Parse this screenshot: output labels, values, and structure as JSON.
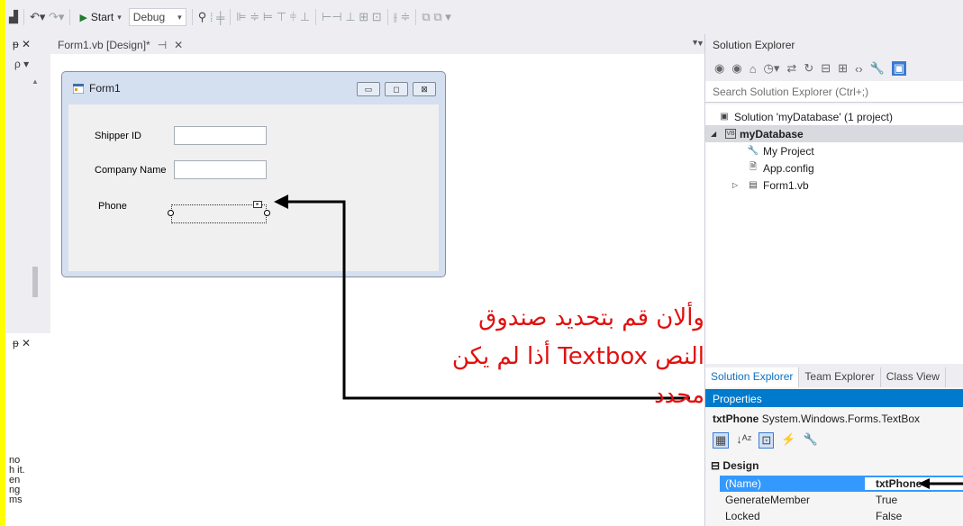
{
  "toolbar": {
    "start_label": "Start",
    "config_value": "Debug"
  },
  "left_panel": {
    "pin": "ᵽ ✕",
    "search": "ρ ▾",
    "lower_pin": "ᵽ ✕",
    "lower_lines": [
      "no",
      "h it.",
      "en",
      "ng",
      "ms"
    ]
  },
  "editor": {
    "tab_label": "Form1.vb [Design]*",
    "tab_pin": "⊣",
    "tab_close": "✕"
  },
  "form": {
    "title": "Form1",
    "fields": [
      {
        "label": "Shipper ID"
      },
      {
        "label": "Company Name"
      },
      {
        "label": "Phone"
      }
    ],
    "caption_buttons": [
      "▭",
      "◻",
      "⊠"
    ]
  },
  "annotation": {
    "lines": [
      "وألان قم بتحديد صندوق",
      "النص  Textbox أذا لم يكن",
      "محدد"
    ],
    "color": "#e01010"
  },
  "solution_explorer": {
    "title": "Solution Explorer",
    "search_placeholder": "Search Solution Explorer (Ctrl+;)",
    "tree": [
      {
        "label": "Solution 'myDatabase' (1 project)"
      },
      {
        "label": "myDatabase"
      },
      {
        "label": "My Project"
      },
      {
        "label": "App.config"
      },
      {
        "label": "Form1.vb"
      }
    ],
    "tabs": [
      "Solution Explorer",
      "Team Explorer",
      "Class View"
    ]
  },
  "properties": {
    "title": "Properties",
    "object_name": "txtPhone",
    "object_type": "System.Windows.Forms.TextBox",
    "category": "Design",
    "rows": [
      {
        "name": "(Name)",
        "value": "txtPhone"
      },
      {
        "name": "GenerateMember",
        "value": "True"
      },
      {
        "name": "Locked",
        "value": "False"
      }
    ]
  }
}
